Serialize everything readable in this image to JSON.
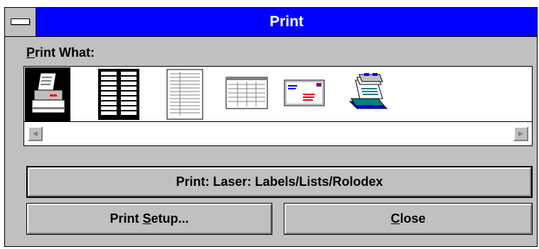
{
  "window": {
    "title": "Print"
  },
  "print_what": {
    "label_prefix": "P",
    "label_rest": "rint What:",
    "icons": [
      {
        "name": "printer-icon",
        "selected": true
      },
      {
        "name": "label-sheet-icon",
        "selected": false
      },
      {
        "name": "list-page-icon",
        "selected": false
      },
      {
        "name": "table-page-icon",
        "selected": false
      },
      {
        "name": "envelope-icon",
        "selected": false
      },
      {
        "name": "rolodex-card-icon",
        "selected": false
      }
    ]
  },
  "buttons": {
    "print_label": "Print: Laser: Labels/Lists/Rolodex",
    "setup_prefix": "Print ",
    "setup_accel": "S",
    "setup_rest": "etup...",
    "close_accel": "C",
    "close_rest": "lose"
  },
  "scrollbar": {
    "left_arrow": "◄",
    "right_arrow": "►"
  }
}
